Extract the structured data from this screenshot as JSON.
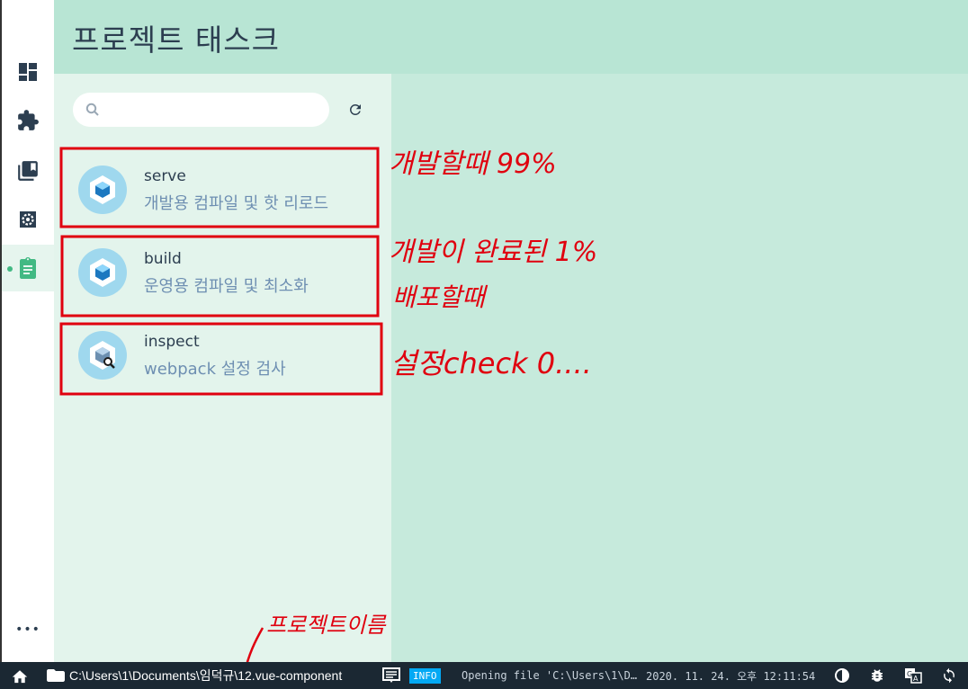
{
  "header": {
    "title": "프로젝트 태스크"
  },
  "search": {
    "placeholder": "",
    "value": ""
  },
  "tasks": [
    {
      "name": "serve",
      "description": "개발용 컴파일 및 핫 리로드"
    },
    {
      "name": "build",
      "description": "운영용 컴파일 및 최소화"
    },
    {
      "name": "inspect",
      "description": "webpack 설정 검사"
    }
  ],
  "sidebar": {
    "items": [
      {
        "icon": "dashboard-icon"
      },
      {
        "icon": "plugins-icon"
      },
      {
        "icon": "dependencies-icon"
      },
      {
        "icon": "configuration-icon"
      },
      {
        "icon": "tasks-icon",
        "active": true
      }
    ],
    "more_label": "•••"
  },
  "annotations": {
    "serve": "개발할때 99%",
    "build_line1": "개발이 완료된 1%",
    "build_line2": "배포할때",
    "inspect": "설정check 0....",
    "project_name": "프로젝트이름"
  },
  "statusbar": {
    "path": "C:\\Users\\1\\Documents\\임덕규\\12.vue-component",
    "log_level": "INFO",
    "log_message": "Opening file 'C:\\Users\\1\\D…",
    "timestamp": "2020. 11. 24. 오후 12:11:54"
  },
  "colors": {
    "accent": "#42b983",
    "header_bg": "#b8e5d4",
    "left_pane_bg": "#e3f4ec",
    "right_pane_bg": "#c6eadc",
    "statusbar_bg": "#1b2833",
    "annotation_red": "#e0000f"
  }
}
